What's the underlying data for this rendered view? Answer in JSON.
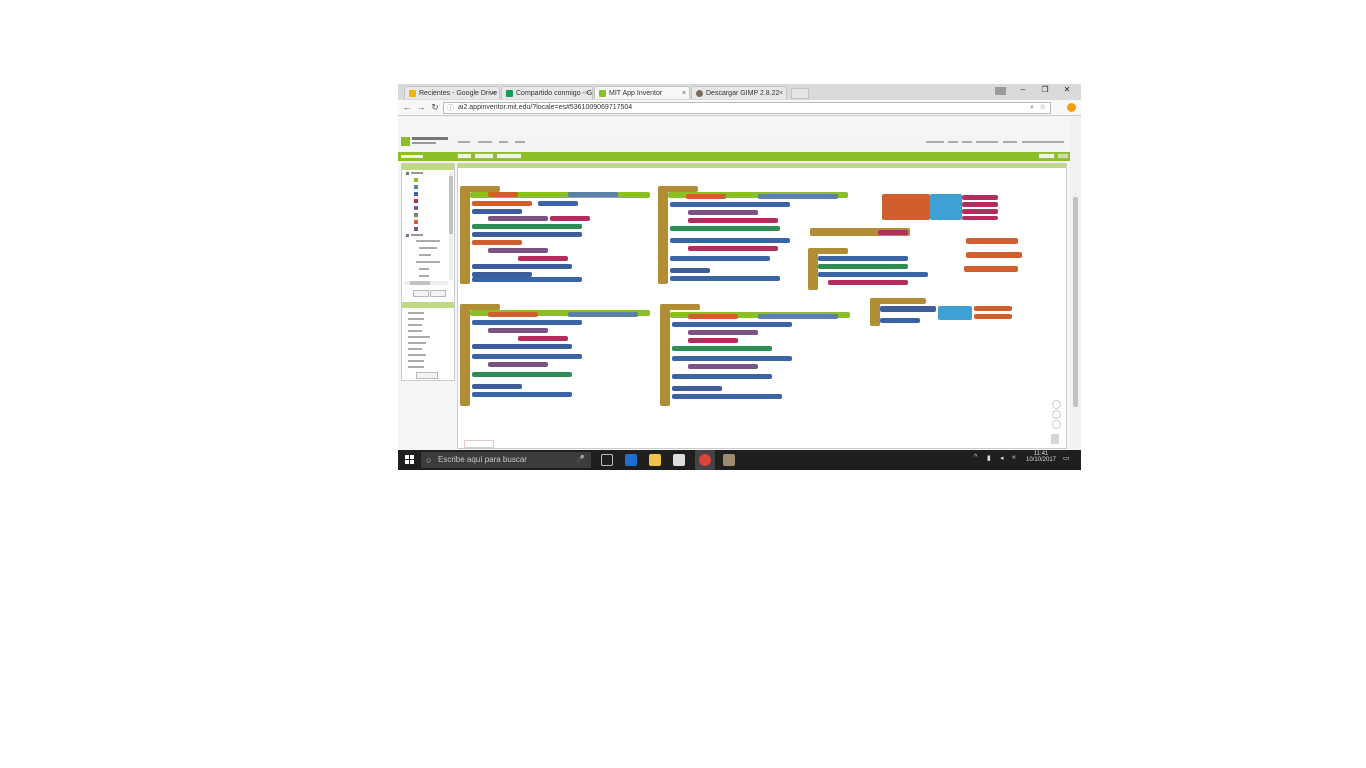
{
  "browser": {
    "tabs": [
      {
        "label": "Recientes - Google Drive",
        "favicon": "google-drive-icon"
      },
      {
        "label": "Compartido conmigo - G",
        "favicon": "google-drive-icon"
      },
      {
        "label": "MIT App Inventor",
        "favicon": "app-inventor-icon",
        "active": true
      },
      {
        "label": "Descargar GIMP 2.8.22",
        "favicon": "gimp-icon"
      }
    ],
    "close_glyph": "×",
    "url": "ai2.appinventor.mit.edu/?locale=es#5361009069717504",
    "window_controls": [
      "–",
      "❐",
      "✕"
    ]
  },
  "taskbar": {
    "search_placeholder": "Escribe aquí para buscar",
    "clock_time": "11:41",
    "clock_date": "10/10/2017"
  },
  "colors": {
    "app_green": "#8cbf26",
    "procedure": "#b18e35",
    "variable_get": "#d05f2d",
    "component_set": "#3d5e9a",
    "math": "#3b64a6",
    "text": "#b32d5e",
    "logic": "#5b80a5",
    "control": "#8cbf26"
  }
}
